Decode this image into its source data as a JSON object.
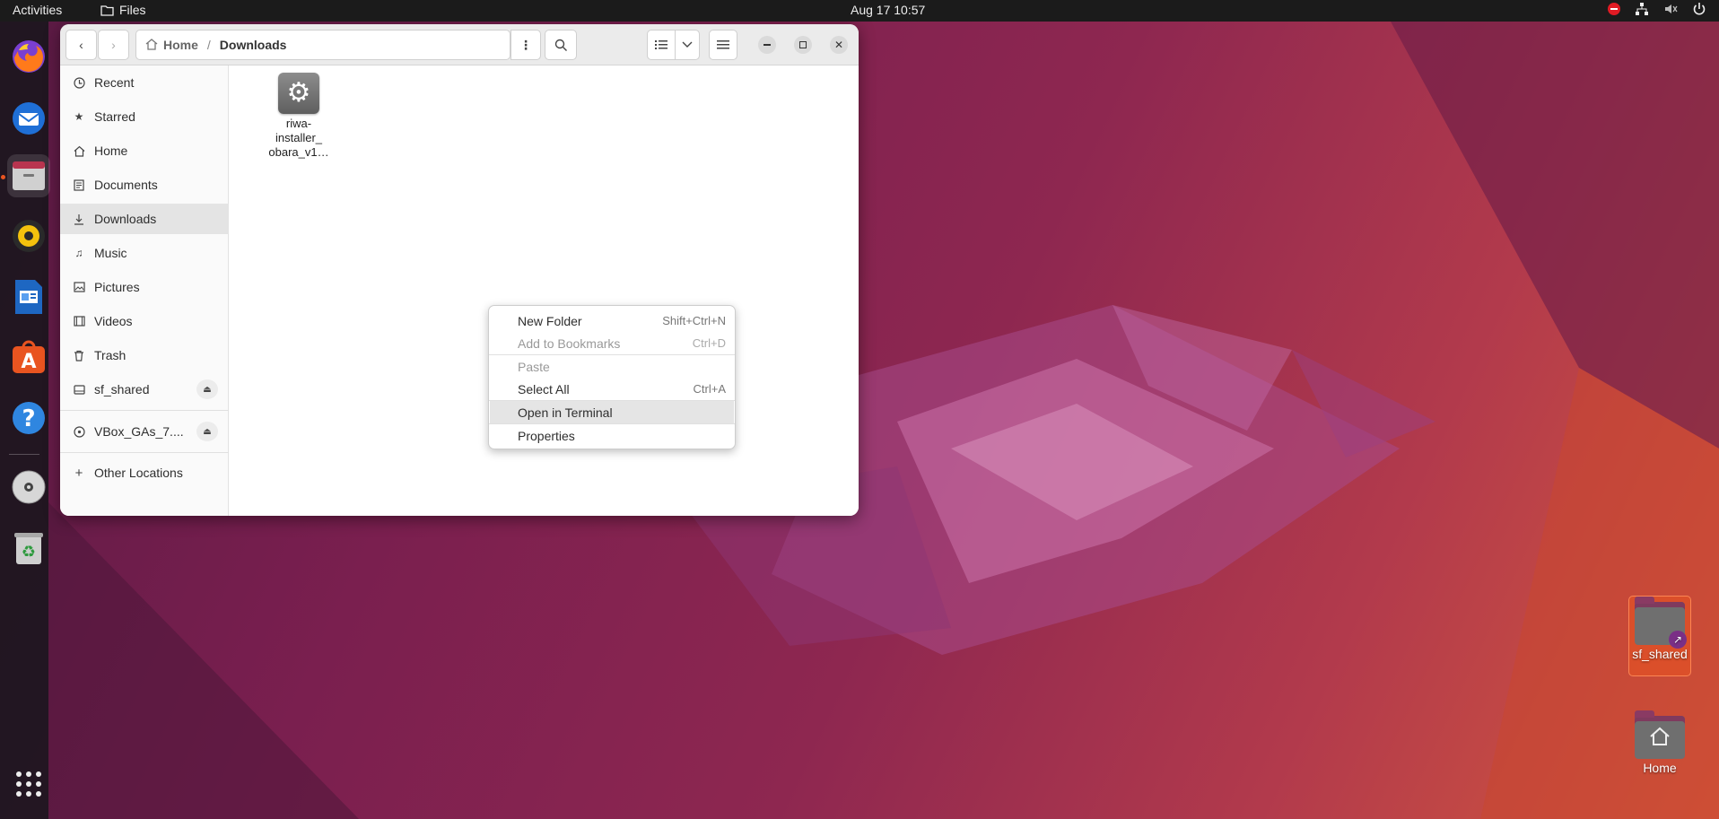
{
  "topbar": {
    "activities": "Activities",
    "app_name": "Files",
    "clock": "Aug 17  10:57",
    "tray_icons": [
      "do-not-disturb-icon",
      "network-icon",
      "volume-muted-icon",
      "power-icon"
    ]
  },
  "dock": {
    "items": [
      {
        "name": "firefox-icon"
      },
      {
        "name": "thunderbird-icon"
      },
      {
        "name": "files-icon",
        "active": true
      },
      {
        "name": "rhythmbox-icon"
      },
      {
        "name": "libreoffice-writer-icon"
      },
      {
        "name": "app-center-icon"
      },
      {
        "name": "help-icon"
      },
      {
        "name": "optical-disc-icon"
      },
      {
        "name": "trash-icon"
      },
      {
        "name": "show-apps-icon"
      }
    ]
  },
  "window": {
    "path": {
      "home": "Home",
      "current": "Downloads",
      "separator": "/"
    },
    "sidebar": {
      "items": [
        {
          "label": "Recent",
          "icon": "clock-icon"
        },
        {
          "label": "Starred",
          "icon": "star-icon"
        },
        {
          "label": "Home",
          "icon": "home-icon"
        },
        {
          "label": "Documents",
          "icon": "document-icon"
        },
        {
          "label": "Downloads",
          "icon": "download-icon",
          "selected": true
        },
        {
          "label": "Music",
          "icon": "music-icon"
        },
        {
          "label": "Pictures",
          "icon": "picture-icon"
        },
        {
          "label": "Videos",
          "icon": "video-icon"
        },
        {
          "label": "Trash",
          "icon": "trash-icon"
        },
        {
          "label": "sf_shared",
          "icon": "drive-icon"
        },
        {
          "label": "VBox_GAs_7....",
          "icon": "disc-icon"
        },
        {
          "label": "Other Locations",
          "icon": "plus-icon"
        }
      ]
    },
    "files": [
      {
        "name": "riwa-\ninstaller_\nobara_v1…"
      }
    ]
  },
  "context_menu": {
    "items": [
      {
        "label": "New Folder",
        "accel": "Shift+Ctrl+N",
        "enabled": true
      },
      {
        "label": "Add to Bookmarks",
        "accel": "Ctrl+D",
        "enabled": false
      },
      {
        "label": "Paste",
        "accel": "",
        "enabled": false
      },
      {
        "label": "Select All",
        "accel": "Ctrl+A",
        "enabled": true
      },
      {
        "label": "Open in Terminal",
        "accel": "",
        "enabled": true,
        "highlighted": true
      },
      {
        "label": "Properties",
        "accel": "",
        "enabled": true
      }
    ]
  },
  "desktop": {
    "icons": [
      {
        "label": "sf_shared"
      },
      {
        "label": "Home"
      }
    ]
  }
}
